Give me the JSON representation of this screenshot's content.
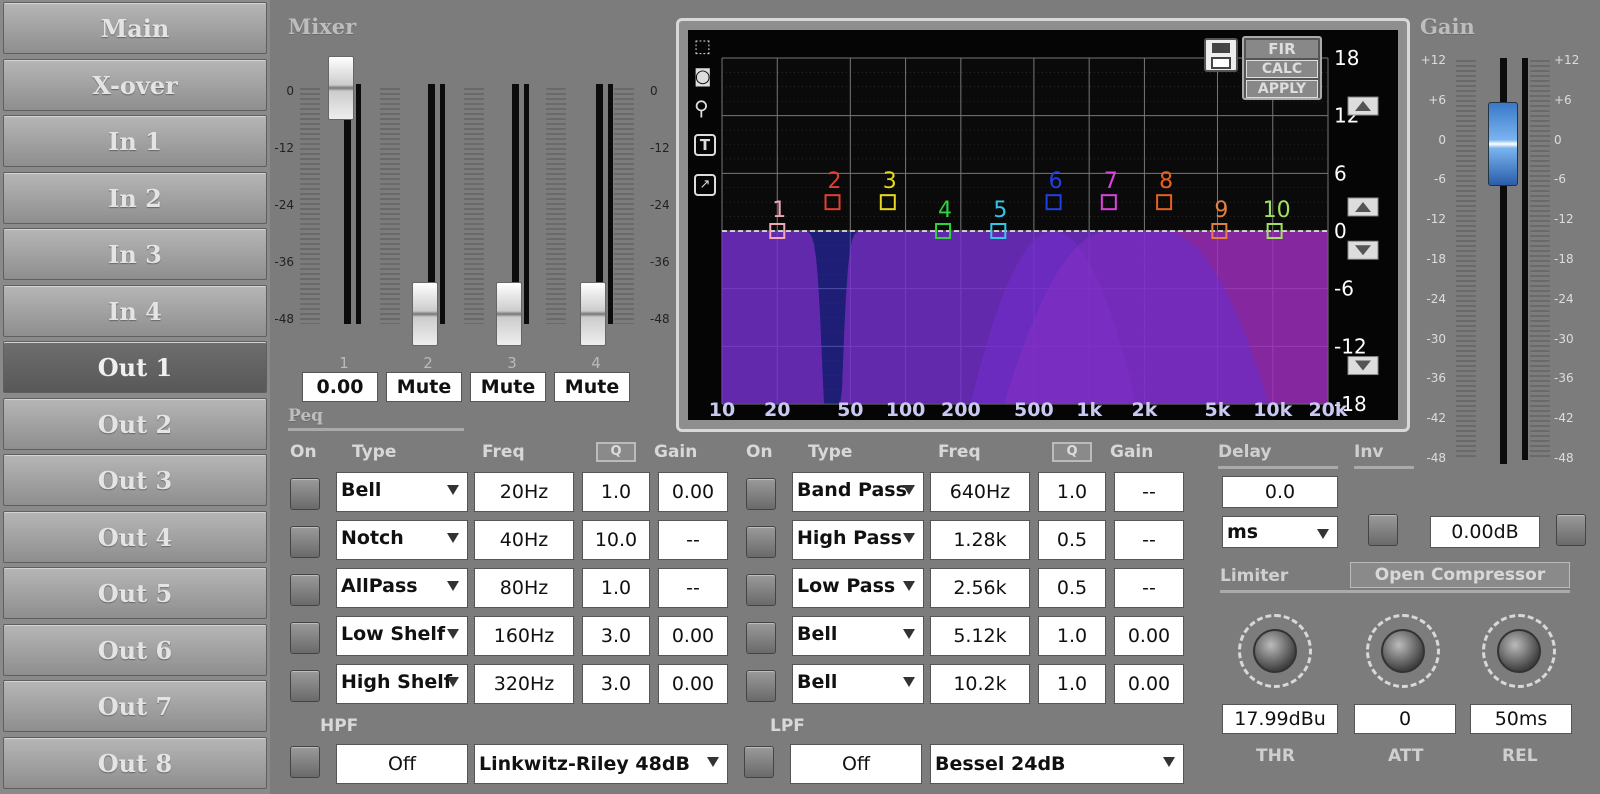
{
  "nav": [
    "Main",
    "X-over",
    "In 1",
    "In 2",
    "In 3",
    "In 4",
    "Out 1",
    "Out 2",
    "Out 3",
    "Out 4",
    "Out 5",
    "Out 6",
    "Out 7",
    "Out 8"
  ],
  "nav_active": "Out 1",
  "mixer": {
    "title": "Mixer",
    "scale_labels": [
      "0",
      "-12",
      "-24",
      "-36",
      "-48"
    ],
    "channels": [
      "1",
      "2",
      "3",
      "4"
    ],
    "values": [
      "0.00",
      "Mute",
      "Mute",
      "Mute"
    ]
  },
  "graph": {
    "y_labels": [
      "18",
      "12",
      "6",
      "0",
      "-6",
      "-12",
      "-18"
    ],
    "x_labels": [
      "10",
      "20",
      "50",
      "100",
      "200",
      "500",
      "1k",
      "2k",
      "5k",
      "10k",
      "20k"
    ],
    "buttons": [
      "FIR",
      "CALC",
      "APPLY"
    ],
    "nodes": [
      {
        "label": "1",
        "color": "#f0a8b8"
      },
      {
        "label": "2",
        "color": "#e04030"
      },
      {
        "label": "3",
        "color": "#e8d820"
      },
      {
        "label": "4",
        "color": "#30d040"
      },
      {
        "label": "5",
        "color": "#30c8e8"
      },
      {
        "label": "6",
        "color": "#2040e0"
      },
      {
        "label": "7",
        "color": "#e040e0"
      },
      {
        "label": "8",
        "color": "#e86020"
      },
      {
        "label": "9",
        "color": "#e08040"
      },
      {
        "label": "10",
        "color": "#a0e060"
      }
    ]
  },
  "gain": {
    "title": "Gain",
    "scale_labels": [
      "+12",
      "+6",
      "0",
      "-6",
      "-12",
      "-18",
      "-24",
      "-30",
      "-36",
      "-42",
      "-48"
    ]
  },
  "peq": {
    "title": "Peq",
    "headers": {
      "on": "On",
      "type": "Type",
      "freq": "Freq",
      "q": "Q",
      "gain": "Gain"
    },
    "left": [
      {
        "type": "Bell",
        "freq": "20Hz",
        "q": "1.0",
        "gain": "0.00"
      },
      {
        "type": "Notch",
        "freq": "40Hz",
        "q": "10.0",
        "gain": "--"
      },
      {
        "type": "AllPass",
        "freq": "80Hz",
        "q": "1.0",
        "gain": "--"
      },
      {
        "type": "Low Shelf",
        "freq": "160Hz",
        "q": "3.0",
        "gain": "0.00"
      },
      {
        "type": "High Shelf",
        "freq": "320Hz",
        "q": "3.0",
        "gain": "0.00"
      }
    ],
    "right": [
      {
        "type": "Band Pass",
        "freq": "640Hz",
        "q": "1.0",
        "gain": "--"
      },
      {
        "type": "High Pass",
        "freq": "1.28k",
        "q": "0.5",
        "gain": "--"
      },
      {
        "type": "Low Pass",
        "freq": "2.56k",
        "q": "0.5",
        "gain": "--"
      },
      {
        "type": "Bell",
        "freq": "5.12k",
        "q": "1.0",
        "gain": "0.00"
      },
      {
        "type": "Bell",
        "freq": "10.2k",
        "q": "1.0",
        "gain": "0.00"
      }
    ]
  },
  "hpf": {
    "label": "HPF",
    "value": "Off",
    "type": "Linkwitz-Riley 48dB"
  },
  "lpf": {
    "label": "LPF",
    "value": "Off",
    "type": "Bessel 24dB"
  },
  "delay": {
    "label": "Delay",
    "value": "0.0",
    "unit": "ms"
  },
  "inv": {
    "label": "Inv",
    "gain_value": "0.00dB"
  },
  "limiter": {
    "label": "Limiter",
    "open_button": "Open Compressor",
    "thr": "17.99dBu",
    "att": "0",
    "rel": "50ms",
    "thr_label": "THR",
    "att_label": "ATT",
    "rel_label": "REL"
  }
}
